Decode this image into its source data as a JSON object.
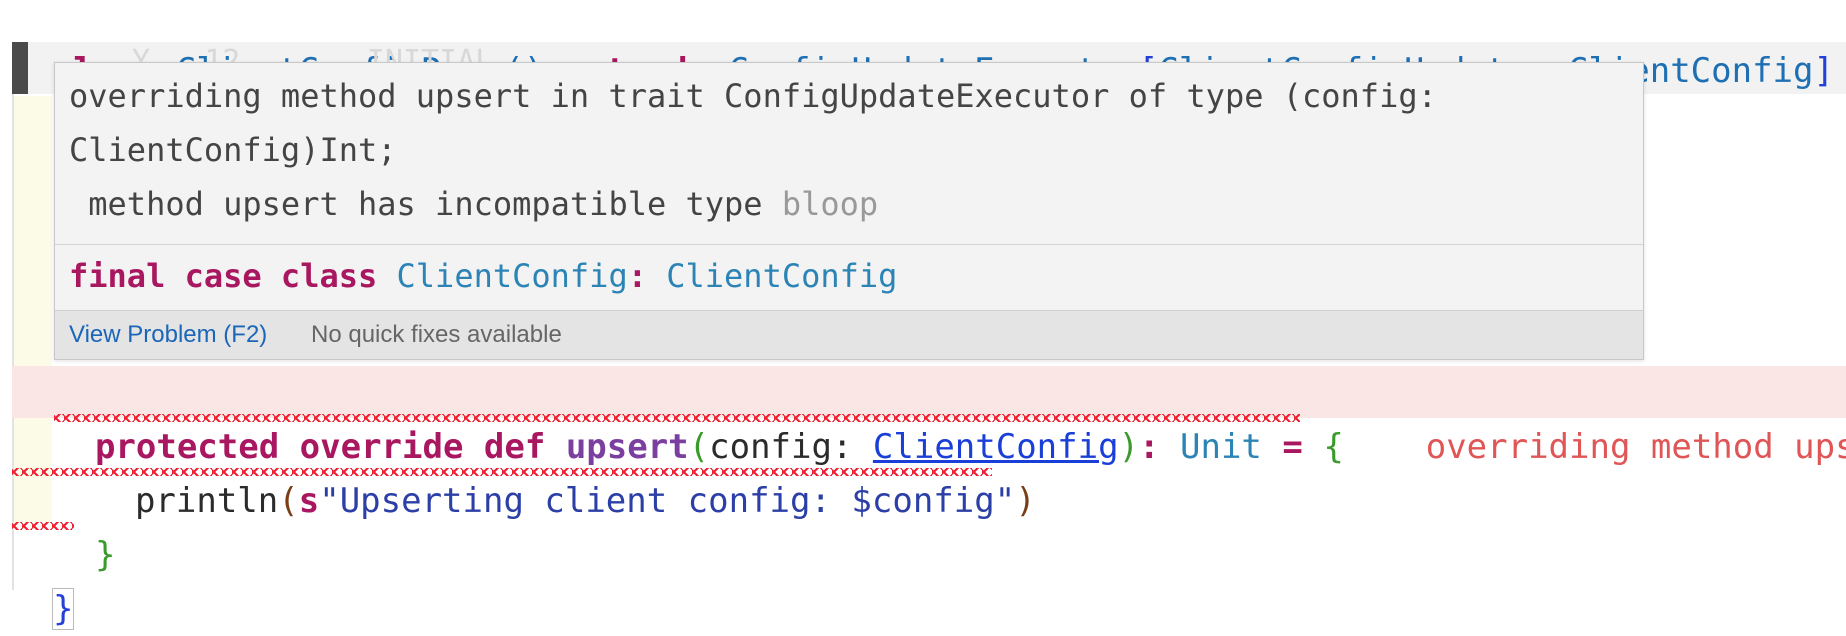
{
  "code": {
    "line1": {
      "kw_class": "class",
      "class_name": "ClientConfigRepo",
      "parens": "()",
      "kw_extends": "extends",
      "parent": "ConfigUpdateExecutor",
      "open_bracket": "[",
      "type_arg1": "ClientConfigUpdate",
      "comma": ", ",
      "type_arg2": "ClientConfig",
      "close_bracket": "]",
      "brace": "{"
    },
    "faded_line": "Y   12       INITIAL",
    "line_override": {
      "kw_protected": "protected",
      "kw_override": "override",
      "kw_def": "def",
      "method": "upsert",
      "open_paren": "(",
      "param": "config: ",
      "param_type": "ClientConfig",
      "close_paren": ")",
      "colon": ":",
      "return_type": "Unit",
      "equals": "=",
      "brace": "{",
      "inline_error": "overriding method upsert"
    },
    "line_println": {
      "call": "println",
      "open_paren": "(",
      "interp": "s",
      "string": "\"Upserting client config: $config\"",
      "close_paren": ")"
    },
    "line_close_inner": "}",
    "line_close_outer": "}"
  },
  "hover": {
    "message_line1": "overriding method upsert in trait ConfigUpdateExecutor of type (config:",
    "message_line2": "ClientConfig)Int;",
    "message_line3": " method upsert has incompatible type",
    "source": "bloop",
    "signature": {
      "kw_final": "final",
      "kw_case": "case",
      "kw_class": "class",
      "name": "ClientConfig",
      "colon": ":",
      "type": "ClientConfig"
    },
    "view_problem": "View Problem (F2)",
    "no_fixes": "No quick fixes available"
  }
}
